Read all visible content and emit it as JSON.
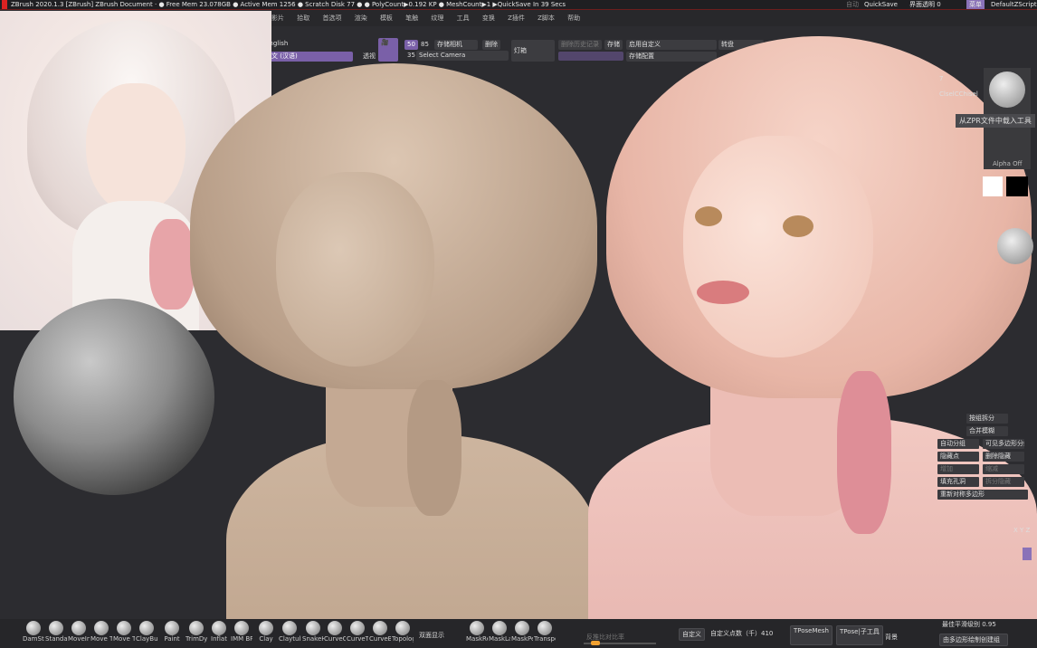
{
  "titlebar": {
    "text": "ZBrush 2020.1.3 [ZBrush]  ZBrush Document  ·  ● Free Mem 23.078GB ● Active Mem 1256 ● Scratch Disk 77 ● ● PolyCount▶0.192 KP ● MeshCount▶1  ▶QuickSave In 39 Secs",
    "quicksave_hint": "自动",
    "quicksave": "QuickSave",
    "transparency": "界面透明 0",
    "menu_button": "菜单",
    "script": "DefaultZScript"
  },
  "menubar": [
    "影片",
    "拾取",
    "首选项",
    "渲染",
    "模板",
    "笔触",
    "纹理",
    "工具",
    "变换",
    "Z插件",
    "Z脚本",
    "帮助"
  ],
  "toolbar": {
    "language_en": "English",
    "language_cn": "中文 (汉语)",
    "perspective_label": "透视",
    "focal_50": "50",
    "focal_85": "85",
    "focal_35": "35",
    "save_camera": "存储相机",
    "delete": "删除",
    "select_camera": "Select Camera",
    "lightbox": "灯箱",
    "clear_history": "删除历史记录",
    "store": "存储",
    "enable_custom": "启用自定义",
    "store_config": "存储配置",
    "rotate": "转盘"
  },
  "rpanel": {
    "brush_names": "ClselCChisel",
    "count": "7",
    "tooltip": "从ZPR文件中载入工具",
    "alpha": "Alpha Off",
    "buttons": [
      "按组拆分",
      "合并模糊",
      "自动分组",
      "可见多边形分组",
      "隐藏点",
      "删除隐藏",
      "增加",
      "缩减",
      "填充孔洞",
      "拆分隐藏",
      "重新对称多边形"
    ],
    "xyz": "X Y Z"
  },
  "shelf": {
    "brushes": [
      "DamStandard",
      "Standard",
      "MoveInfinite",
      "Move Topological",
      "Move Tube",
      "ClayBuildup",
      "Paint",
      "TrimDynamic",
      "Inflat",
      "IMM BParts",
      "Clay",
      "Claytubes",
      "SnakeHook",
      "CurveQuadFill",
      "CurveTube",
      "CurveBridge",
      "Topology"
    ],
    "double_sided": "双面显示",
    "masks": [
      "MaskRect",
      "MaskLasso",
      "MaskPen",
      "TransposeSmart"
    ],
    "ratio": "反推比对比率",
    "custom": "自定义",
    "custom_points": "自定义点数（千）410",
    "tpose_mesh": "TPoseMesh",
    "tpose_sub": "TPose|子工具",
    "background": "背景",
    "smooth_label": "最佳平滑级别 0.95",
    "poly_build": "由多边形绘制创建组"
  }
}
